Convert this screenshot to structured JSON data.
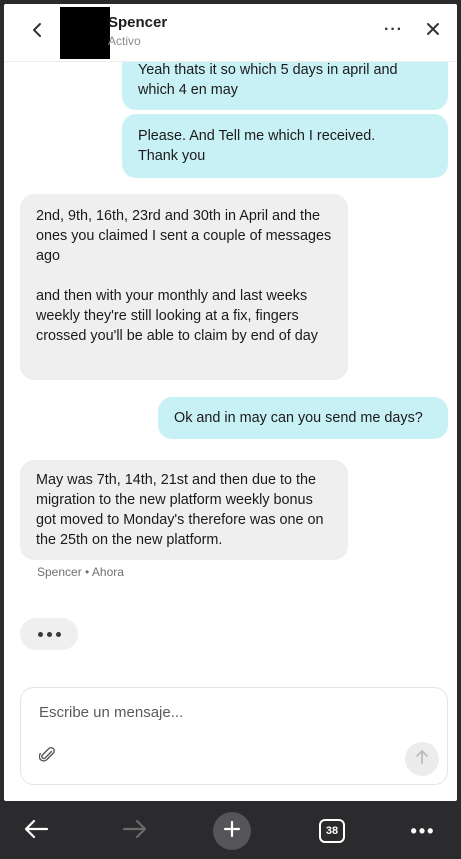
{
  "header": {
    "contact_name": "Spencer",
    "contact_status": "Activo"
  },
  "messages": [
    {
      "direction": "outgoing",
      "lines": [
        "Yeah thats it so which 5 days in april and",
        "which 4 en may"
      ]
    },
    {
      "direction": "outgoing",
      "lines": [
        "Please. And Tell me which I received.",
        "Thank you"
      ]
    },
    {
      "direction": "incoming",
      "paragraphs": [
        "2nd, 9th, 16th, 23rd and 30th in April and the ones you claimed I sent a couple of messages ago",
        "and then with your monthly and last weeks weekly they're still looking at a fix, fingers crossed you'll be able to claim by end of day"
      ]
    },
    {
      "direction": "outgoing",
      "lines": [
        "Ok and in may can you send me days?"
      ]
    },
    {
      "direction": "incoming",
      "paragraphs": [
        "May was 7th, 14th, 21st and then due to the migration to the new platform weekly bonus got moved to Monday's therefore was one on the 25th on the new platform."
      ]
    }
  ],
  "meta": {
    "sender": "Spencer",
    "separator": "•",
    "time": "Ahora"
  },
  "composer": {
    "placeholder": "Escribe un mensaje..."
  },
  "browser_bar": {
    "tab_count": "38"
  },
  "colors": {
    "outgoing_bubble": "#c8f1f6",
    "incoming_bubble": "#efefef",
    "bar_bg": "#2b2b2d"
  },
  "icons": [
    "chevron-left-icon",
    "more-horizontal-icon",
    "close-icon",
    "paperclip-icon",
    "arrow-up-icon",
    "arrow-left-icon",
    "arrow-right-icon",
    "plus-icon",
    "tabs-icon",
    "more-dots-icon"
  ]
}
